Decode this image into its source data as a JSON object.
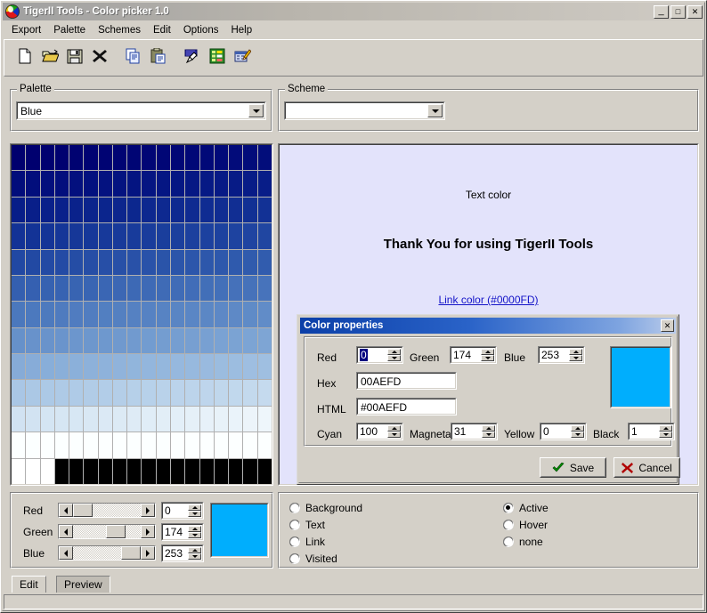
{
  "window": {
    "title": "TigerII Tools - Color picker 1.0",
    "icon": "tiger-logo-icon",
    "minimize_label": "_",
    "maximize_label": "□",
    "close_label": "✕"
  },
  "menubar": {
    "items": [
      {
        "label": "Export",
        "name": "menu-export"
      },
      {
        "label": "Palette",
        "name": "menu-palette"
      },
      {
        "label": "Schemes",
        "name": "menu-schemes"
      },
      {
        "label": "Edit",
        "name": "menu-edit"
      },
      {
        "label": "Options",
        "name": "menu-options"
      },
      {
        "label": "Help",
        "name": "menu-help"
      }
    ]
  },
  "toolbar": {
    "buttons": [
      {
        "icon": "new-file-icon",
        "gap": false
      },
      {
        "icon": "open-folder-icon",
        "gap": false
      },
      {
        "icon": "save-disk-icon",
        "gap": false
      },
      {
        "icon": "delete-x-icon",
        "gap": false
      },
      {
        "icon": "copy-icon",
        "gap": true
      },
      {
        "icon": "paste-icon",
        "gap": false
      },
      {
        "icon": "palette-brush-icon",
        "gap": true
      },
      {
        "icon": "color-list-icon",
        "gap": false
      },
      {
        "icon": "edit-pencil-icon",
        "gap": false
      }
    ]
  },
  "palette_group": {
    "legend": "Palette",
    "selected": "Blue"
  },
  "scheme_group": {
    "legend": "Scheme",
    "selected": ""
  },
  "preview": {
    "background_color": "#e3e3fb",
    "text_label": "Text color",
    "heading": "Thank You for using TigerII Tools",
    "link_label": "Link color (#0000FD)",
    "link_color": "#1414c8"
  },
  "dialog": {
    "title": "Color properties",
    "close_label": "✕",
    "rgb": [
      {
        "label": "Red",
        "value": "0",
        "selected": true
      },
      {
        "label": "Green",
        "value": "174",
        "selected": false
      },
      {
        "label": "Blue",
        "value": "253",
        "selected": false
      }
    ],
    "hex_label": "Hex",
    "hex_value": "00AEFD",
    "html_label": "HTML",
    "html_value": "#00AEFD",
    "cmyk": [
      {
        "label": "Cyan",
        "value": "100"
      },
      {
        "label": "Magneta",
        "value": "31"
      },
      {
        "label": "Yellow",
        "value": "0"
      },
      {
        "label": "Black",
        "value": "1"
      }
    ],
    "preview_color": "#00aefd",
    "save_label": "Save",
    "cancel_label": "Cancel"
  },
  "editor": {
    "channels": [
      {
        "label": "Red",
        "value": "0",
        "pct": 0.0
      },
      {
        "label": "Green",
        "value": "174",
        "pct": 0.682
      },
      {
        "label": "Blue",
        "value": "253",
        "pct": 0.992
      }
    ],
    "swatch_color": "#00aefd"
  },
  "targets": {
    "left": [
      {
        "label": "Background",
        "selected": false
      },
      {
        "label": "Text",
        "selected": false
      },
      {
        "label": "Link",
        "selected": false
      },
      {
        "label": "Visited",
        "selected": false
      }
    ],
    "right": [
      {
        "label": "Active",
        "selected": true
      },
      {
        "label": "Hover",
        "selected": false
      },
      {
        "label": "none",
        "selected": false
      }
    ]
  },
  "tabs": [
    {
      "label": "Edit",
      "state": "active"
    },
    {
      "label": "Preview",
      "state": "pressed"
    }
  ],
  "palette_grid": {
    "columns": 18,
    "rows": 13,
    "base_hue": "blue",
    "description": "Grid of blue gradient swatches from dark navy at top to white, with a black final row"
  }
}
